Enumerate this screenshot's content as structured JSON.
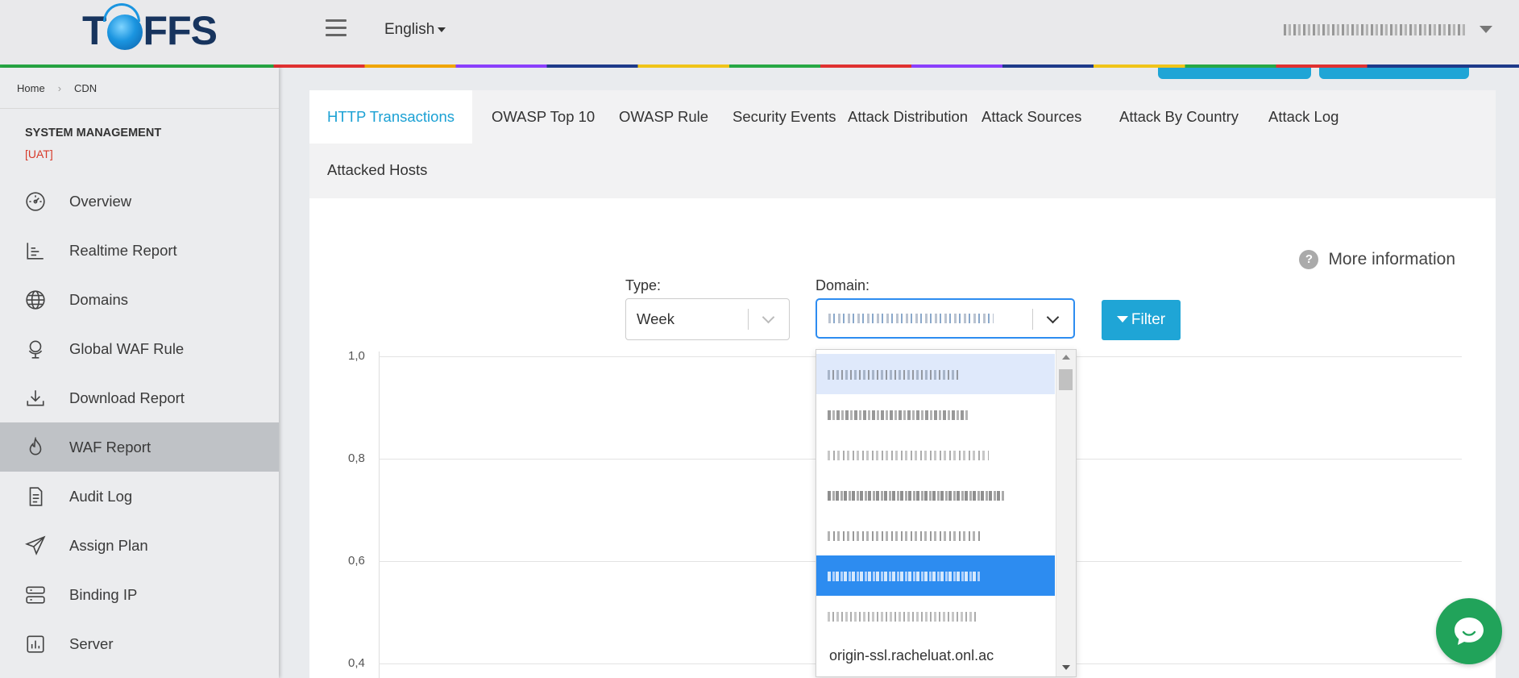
{
  "app": {
    "logo_text": "TOFFS"
  },
  "header": {
    "language": "English",
    "user_name": ""
  },
  "breadcrumb": {
    "home": "Home",
    "current": "CDN"
  },
  "sidebar": {
    "section_title": "SYSTEM MANAGEMENT",
    "env": "[UAT]",
    "items": [
      {
        "label": "Overview",
        "icon": "dashboard-gauge-icon"
      },
      {
        "label": "Realtime Report",
        "icon": "bar-chart-icon"
      },
      {
        "label": "Domains",
        "icon": "globe-icon"
      },
      {
        "label": "Global WAF Rule",
        "icon": "globe-stand-icon"
      },
      {
        "label": "Download Report",
        "icon": "download-icon"
      },
      {
        "label": "WAF Report",
        "icon": "flame-icon",
        "active": true
      },
      {
        "label": "Audit Log",
        "icon": "document-icon"
      },
      {
        "label": "Assign Plan",
        "icon": "paper-plane-icon"
      },
      {
        "label": "Binding IP",
        "icon": "server-rack-icon"
      },
      {
        "label": "Server",
        "icon": "server-chart-icon"
      }
    ]
  },
  "tabs": [
    {
      "label": "HTTP Transactions",
      "active": true
    },
    {
      "label": "OWASP Top 10"
    },
    {
      "label": "OWASP Rule"
    },
    {
      "label": "Security Events"
    },
    {
      "label": "Attack Distribution"
    },
    {
      "label": "Attack Sources"
    },
    {
      "label": "Attack By Country"
    },
    {
      "label": "Attack Log"
    },
    {
      "label": "Attacked Hosts"
    }
  ],
  "filters": {
    "more_info": "More information",
    "type_label": "Type:",
    "type_value": "Week",
    "domain_label": "Domain:",
    "domain_value": "",
    "filter_button": "Filter"
  },
  "domain_options": [
    {
      "text": "",
      "state": "hover"
    },
    {
      "text": ""
    },
    {
      "text": ""
    },
    {
      "text": ""
    },
    {
      "text": ""
    },
    {
      "text": "",
      "state": "selected"
    },
    {
      "text": ""
    },
    {
      "text": "origin-ssl.racheluat.onl.ac"
    }
  ],
  "chart_data": {
    "type": "line",
    "yticks": [
      "1,0",
      "0,8",
      "0,6",
      "0,4"
    ],
    "ylim": [
      0,
      1
    ],
    "series": []
  },
  "colors": {
    "accent": "#1fa5d6",
    "select_border": "#2d8cf0",
    "env": "#d73a2a",
    "chat": "#21a35a"
  }
}
